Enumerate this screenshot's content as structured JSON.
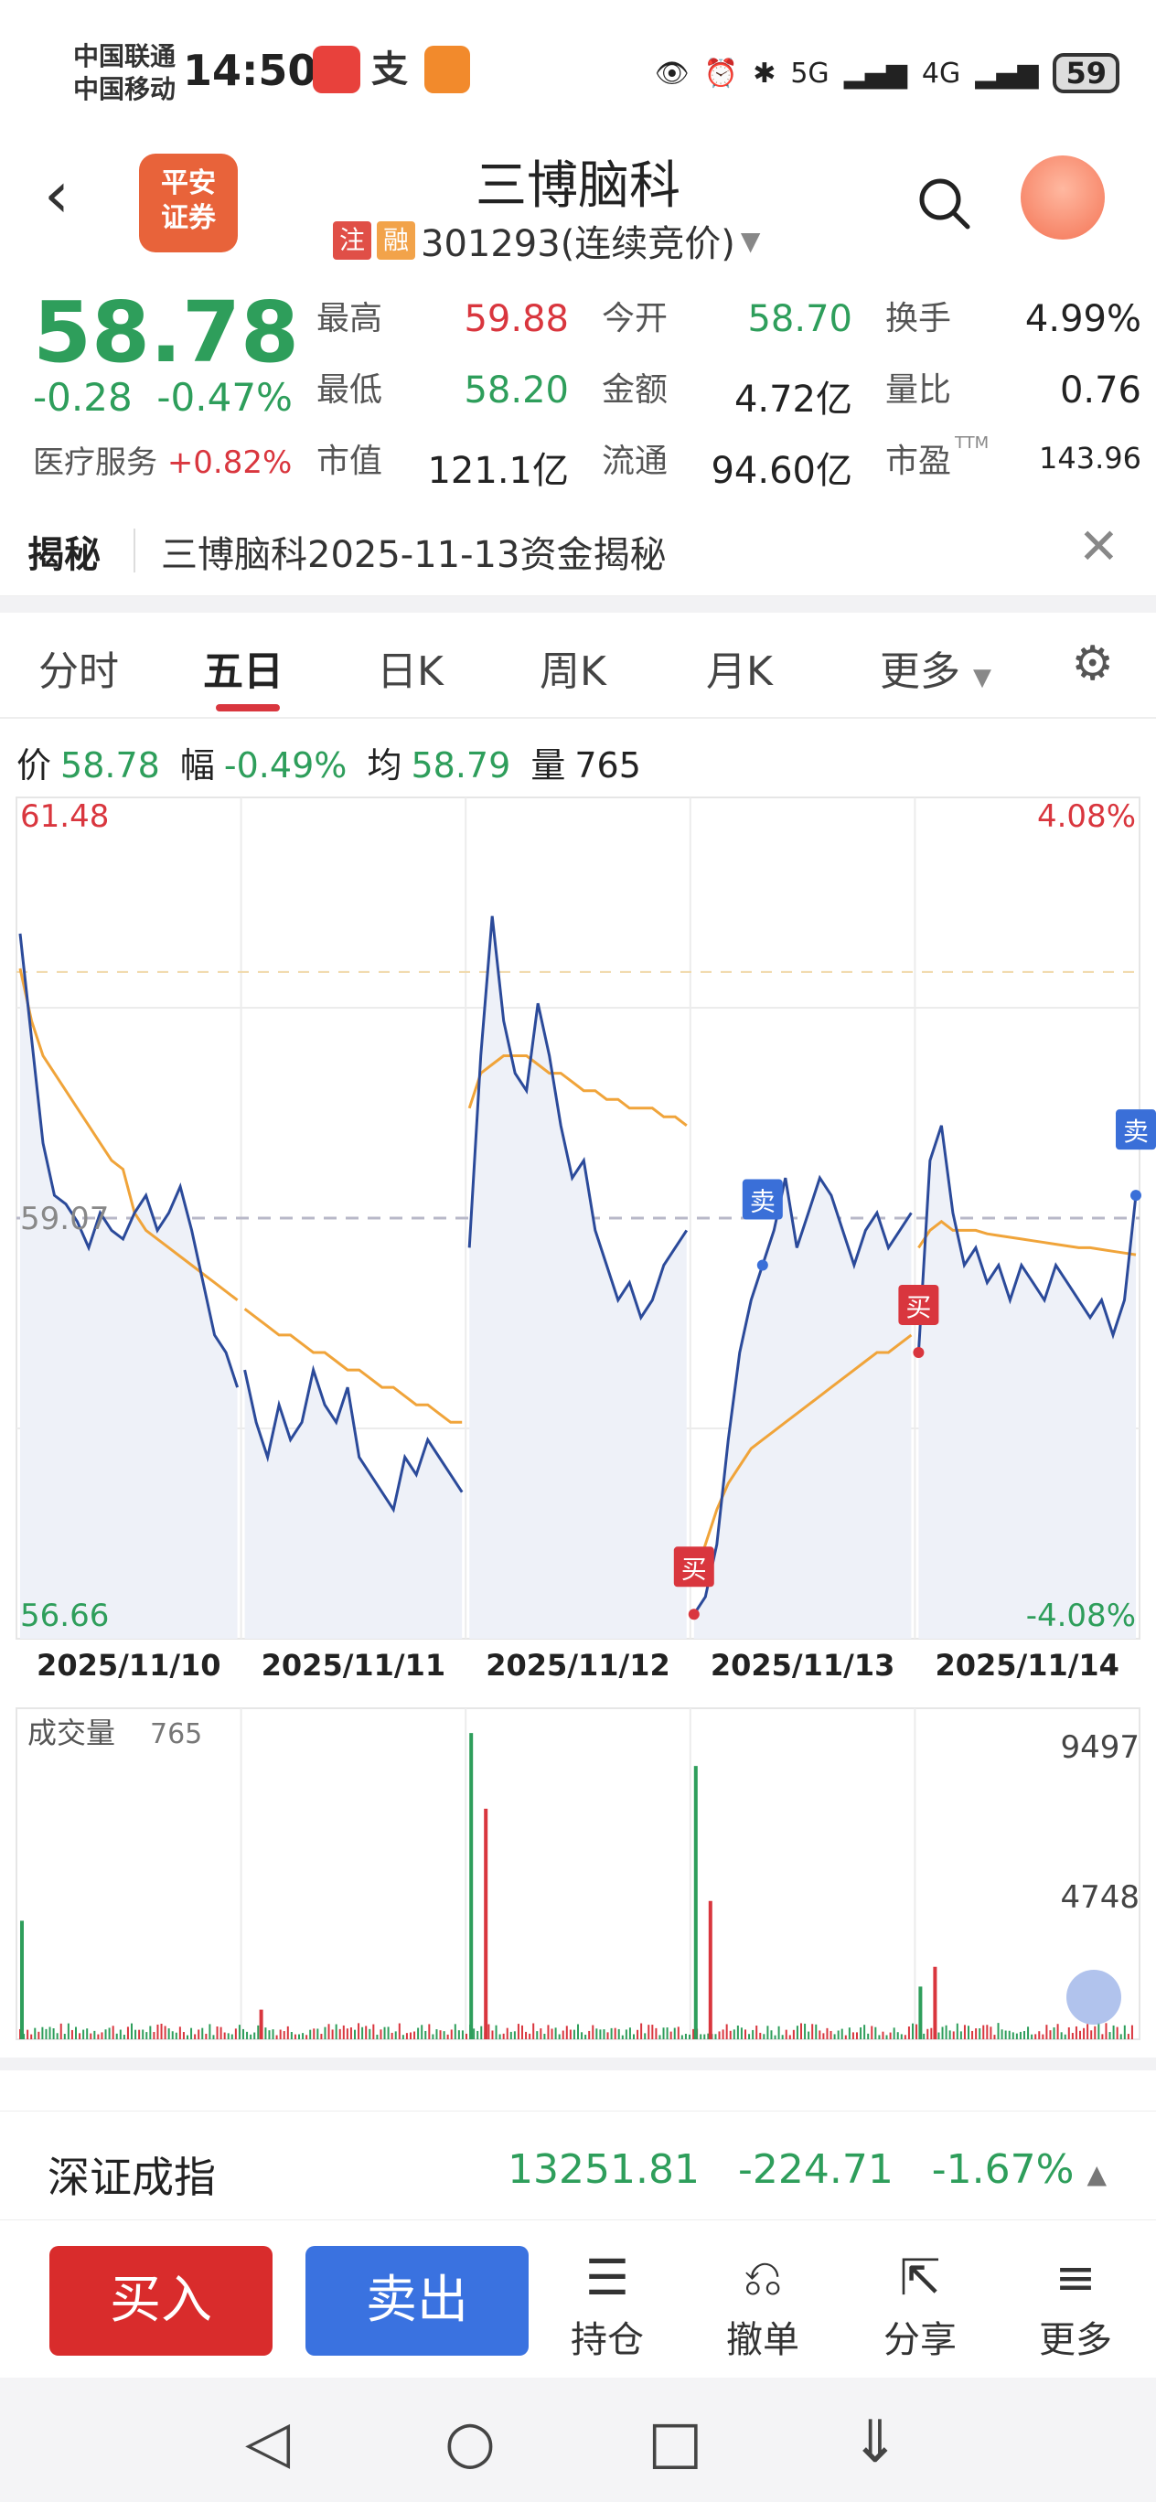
{
  "statusbar": {
    "carrier1": "中国联通",
    "carrier2": "中国移动",
    "time": "14:50",
    "battery": "59",
    "signal1": "5G",
    "signal2": "4G"
  },
  "header": {
    "back_icon": "chevron-left-icon",
    "logo_line1": "平安",
    "logo_line2": "证券",
    "name": "三博脑科",
    "tag_zhu": "注",
    "tag_rong": "融",
    "code_status": "301293(连续竞价)",
    "dropdown_icon": "triangle-down-icon",
    "search_icon": "search-icon",
    "avatar_icon": "chatbot-avatar-icon"
  },
  "quote": {
    "price": "58.78",
    "change": "-0.28",
    "change_pct": "-0.47%",
    "sector_name": "医疗服务",
    "sector_change": "+0.82%",
    "stats": [
      {
        "label": "最高",
        "value": "59.88",
        "color": "red"
      },
      {
        "label": "今开",
        "value": "58.70",
        "color": "green"
      },
      {
        "label": "换手",
        "value": "4.99%",
        "color": "dark"
      },
      {
        "label": "最低",
        "value": "58.20",
        "color": "green"
      },
      {
        "label": "金额",
        "value": "4.72亿",
        "color": "dark"
      },
      {
        "label": "量比",
        "value": "0.76",
        "color": "dark"
      },
      {
        "label": "市值",
        "value": "121.1亿",
        "color": "dark"
      },
      {
        "label": "流通",
        "value": "94.60亿",
        "color": "dark"
      },
      {
        "label": "市盈",
        "value": "143.96",
        "color": "dark",
        "sup": "TTM"
      }
    ]
  },
  "notice": {
    "title": "揭秘",
    "text": "三博脑科2025-11-13资金揭秘",
    "close_icon": "close-icon"
  },
  "tabs": {
    "items": [
      "分时",
      "五日",
      "日K",
      "周K",
      "月K",
      "更多"
    ],
    "active": "五日",
    "settings_icon": "gear-icon"
  },
  "infobar": {
    "price_label": "价",
    "price": "58.78",
    "range_label": "幅",
    "range": "-0.49%",
    "avg_label": "均",
    "avg": "58.79",
    "vol_label": "量",
    "vol": "765"
  },
  "chart_data": {
    "type": "line",
    "title": "",
    "price_axis": {
      "max": "61.48",
      "min": "56.66",
      "ref": "59.07",
      "pct_max": "4.08%",
      "pct_min": "-4.08%"
    },
    "dates": [
      "2025/11/10",
      "2025/11/11",
      "2025/11/12",
      "2025/11/13",
      "2025/11/14"
    ],
    "ylim": [
      56.66,
      61.48
    ],
    "series": [
      {
        "values": [
          60.7,
          60.1,
          59.5,
          59.2,
          59.15,
          59.05,
          58.9,
          59.1,
          59.0,
          58.95,
          59.1,
          59.2,
          59.0,
          59.1,
          59.25,
          59.0,
          58.7,
          58.4,
          58.3,
          58.1,
          58.2,
          57.9,
          57.7,
          58.0,
          57.8,
          57.9,
          58.2,
          58.0,
          57.9,
          58.1,
          57.7,
          57.6,
          57.5,
          57.4,
          57.7,
          57.6,
          57.8,
          57.7,
          57.6,
          57.5,
          58.9,
          60.0,
          60.8,
          60.2,
          59.9,
          59.8,
          60.3,
          60.0,
          59.6,
          59.3,
          59.4,
          59.0,
          58.8,
          58.6,
          58.7,
          58.5,
          58.6,
          58.8,
          58.9,
          59.0,
          56.8,
          56.9,
          57.2,
          57.8,
          58.3,
          58.6,
          58.8,
          59.0,
          59.3,
          58.9,
          59.1,
          59.3,
          59.2,
          59.0,
          58.8,
          59.0,
          59.1,
          58.9,
          59.0,
          59.1,
          58.3,
          59.4,
          59.6,
          59.1,
          58.8,
          58.9,
          58.7,
          58.8,
          58.6,
          58.8,
          58.7,
          58.6,
          58.8,
          58.7,
          58.6,
          58.5,
          58.6,
          58.4,
          58.6,
          59.2
        ]
      },
      {
        "values": [
          60.5,
          60.2,
          60.0,
          59.9,
          59.8,
          59.7,
          59.6,
          59.5,
          59.4,
          59.35,
          59.1,
          59.0,
          58.95,
          58.9,
          58.85,
          58.8,
          58.75,
          58.7,
          58.65,
          58.6,
          58.55,
          58.5,
          58.45,
          58.4,
          58.4,
          58.35,
          58.3,
          58.3,
          58.25,
          58.2,
          58.2,
          58.15,
          58.1,
          58.1,
          58.05,
          58.0,
          58.0,
          57.95,
          57.9,
          57.9,
          59.7,
          59.9,
          59.95,
          60.0,
          60.0,
          60.0,
          59.95,
          59.9,
          59.9,
          59.85,
          59.8,
          59.8,
          59.75,
          59.75,
          59.7,
          59.7,
          59.7,
          59.65,
          59.65,
          59.6,
          57.0,
          57.2,
          57.4,
          57.55,
          57.65,
          57.75,
          57.8,
          57.85,
          57.9,
          57.95,
          58.0,
          58.05,
          58.1,
          58.15,
          58.2,
          58.25,
          58.3,
          58.3,
          58.35,
          58.4,
          58.9,
          59.0,
          59.05,
          59.0,
          59.0,
          59.0,
          58.98,
          58.97,
          58.96,
          58.95,
          58.94,
          58.93,
          58.92,
          58.91,
          58.9,
          58.9,
          58.89,
          58.88,
          58.87,
          58.86
        ]
      }
    ],
    "markers": [
      {
        "label": "卖",
        "color": "#3a6fd8"
      },
      {
        "label": "买",
        "color": "#d9363e"
      },
      {
        "label": "买",
        "color": "#d9363e"
      },
      {
        "label": "卖",
        "color": "#3a6fd8"
      }
    ],
    "volume": {
      "label": "成交量",
      "current": "765",
      "ticks": [
        "9497",
        "4748"
      ],
      "max": 9497,
      "peaks": [
        {
          "day": 0,
          "value": 3600
        },
        {
          "day": 1,
          "value": 900
        },
        {
          "day": 2,
          "value": 9300
        },
        {
          "day": 2,
          "value": 7000
        },
        {
          "day": 3,
          "value": 8300
        },
        {
          "day": 3,
          "value": 4200
        },
        {
          "day": 4,
          "value": 1600
        },
        {
          "day": 4,
          "value": 2200
        }
      ]
    }
  },
  "index": {
    "name": "深证成指",
    "value": "13251.81",
    "change": "-224.71",
    "change_pct": "-1.67%",
    "arrow_icon": "triangle-up-icon"
  },
  "bottombar": {
    "buy": "买入",
    "sell": "卖出",
    "tools": [
      {
        "label": "持仓",
        "icon": "list-document-icon"
      },
      {
        "label": "撤单",
        "icon": "undo-order-icon"
      },
      {
        "label": "分享",
        "icon": "share-icon"
      },
      {
        "label": "更多",
        "icon": "menu-lines-icon"
      }
    ]
  },
  "navbar": {
    "back": "nav-back-icon",
    "home": "nav-home-icon",
    "recents": "nav-recents-icon",
    "pull": "nav-pulldown-icon"
  }
}
